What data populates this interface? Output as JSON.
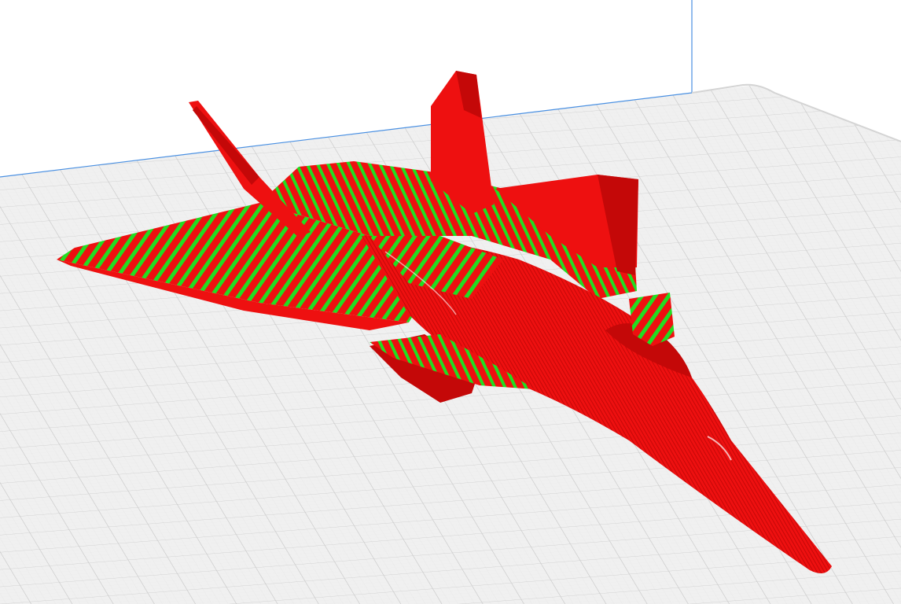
{
  "app": {
    "view": "layer-preview"
  },
  "scene": {
    "background_color": "#ffffff",
    "build_plate": {
      "fill_color": "#f0f0f0",
      "grid_major_color": "#c8c8c8",
      "grid_minor_color": "#e2e2e2",
      "edge_color": "#4a90e2"
    },
    "model": {
      "name_icon": "fighter-jet-model",
      "wall_color": "#ee1010",
      "wall_shade_color": "#c40808",
      "infill_color": "#22dd22"
    }
  }
}
